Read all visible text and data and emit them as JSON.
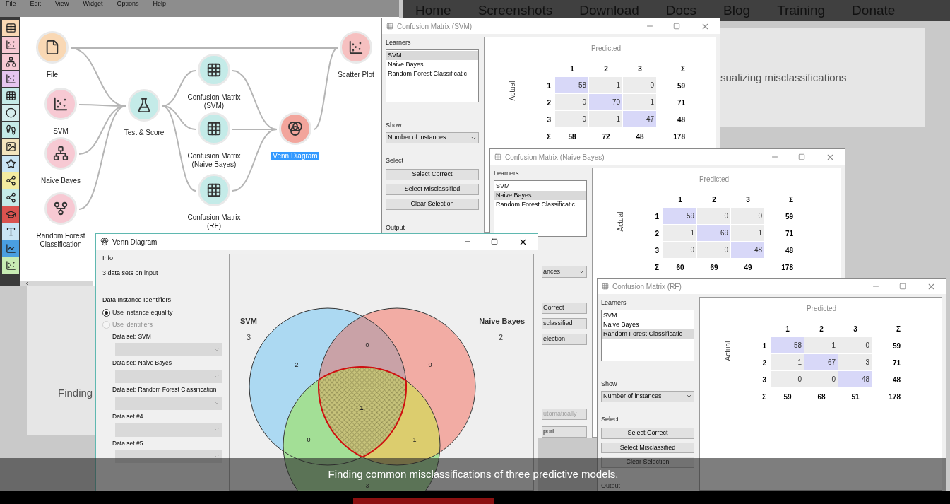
{
  "site_nav": [
    "Home",
    "Screenshots",
    "Download",
    "Docs",
    "Blog",
    "Training",
    "Donate"
  ],
  "page_texts": [
    "sualizing misclassifications",
    "Finding"
  ],
  "orange": {
    "menu": [
      "File",
      "Edit",
      "View",
      "Widget",
      "Options",
      "Help"
    ],
    "nodes": [
      {
        "kind": "file",
        "label": [
          "File"
        ],
        "selected": false
      },
      {
        "kind": "svm",
        "label": [
          "SVM"
        ],
        "selected": false
      },
      {
        "kind": "bayes",
        "label": [
          "Naive Bayes"
        ],
        "selected": false
      },
      {
        "kind": "forest",
        "label": [
          "Random Forest",
          "Classification"
        ],
        "selected": false
      },
      {
        "kind": "evaluate",
        "label": [
          "Test & Score"
        ],
        "selected": false
      },
      {
        "kind": "matrix",
        "label": [
          "Confusion Matrix",
          "(SVM)"
        ],
        "selected": false
      },
      {
        "kind": "matrix",
        "label": [
          "Confusion Matrix",
          "(Naive Bayes)"
        ],
        "selected": false
      },
      {
        "kind": "matrix",
        "label": [
          "Confusion Matrix",
          "(RF)"
        ],
        "selected": false
      },
      {
        "kind": "venn",
        "label": [
          "Venn Diagram"
        ],
        "selected": true
      },
      {
        "kind": "scatter",
        "label": [
          "Scatter Plot"
        ],
        "selected": false
      }
    ]
  },
  "confusion_windows": [
    {
      "title": "Confusion Matrix (SVM)",
      "learners_title": "Learners",
      "learners": [
        {
          "name": "SVM",
          "selected": true
        },
        {
          "name": "Naive Bayes",
          "selected": false
        },
        {
          "name": "Random Forest Classificatic",
          "selected": false
        }
      ],
      "show_title": "Show",
      "show_value": "Number of instances",
      "select_title": "Select",
      "buttons": [
        "Select Correct",
        "Select Misclassified",
        "Clear Selection"
      ],
      "output_title": "Output",
      "predicted": "Predicted",
      "actual": "Actual",
      "columns": [
        "1",
        "2",
        "3",
        "Σ"
      ],
      "rows": [
        {
          "label": "1",
          "cells": [
            {
              "value": "58",
              "highlighted": true
            },
            {
              "value": "1",
              "highlighted": false
            },
            {
              "value": "0",
              "highlighted": false
            }
          ],
          "total": "59"
        },
        {
          "label": "2",
          "cells": [
            {
              "value": "0",
              "highlighted": false
            },
            {
              "value": "70",
              "highlighted": true
            },
            {
              "value": "1",
              "highlighted": false
            }
          ],
          "total": "71"
        },
        {
          "label": "3",
          "cells": [
            {
              "value": "0",
              "highlighted": false
            },
            {
              "value": "1",
              "highlighted": false
            },
            {
              "value": "47",
              "highlighted": true
            }
          ],
          "total": "48"
        }
      ],
      "sum_row": {
        "label": "Σ",
        "cells": [
          "58",
          "72",
          "48"
        ],
        "total": "178"
      }
    },
    {
      "title": "Confusion Matrix (Naive Bayes)",
      "learners_title": "Learners",
      "learners": [
        {
          "name": "SVM",
          "selected": false
        },
        {
          "name": "Naive Bayes",
          "selected": true
        },
        {
          "name": "Random Forest Classificatic",
          "selected": false
        }
      ],
      "visible_controls": [
        {
          "kind": "dropdown",
          "text": "ances",
          "disabled": false
        },
        {
          "kind": "button",
          "text": "Correct",
          "disabled": false
        },
        {
          "kind": "button",
          "text": "sclassified",
          "disabled": false
        },
        {
          "kind": "button",
          "text": "election",
          "disabled": false
        },
        {
          "kind": "button",
          "text": "utomatically",
          "disabled": true
        },
        {
          "kind": "button",
          "text": "port",
          "disabled": false
        }
      ],
      "predicted": "Predicted",
      "actual": "Actual",
      "columns": [
        "1",
        "2",
        "3",
        "Σ"
      ],
      "rows": [
        {
          "label": "1",
          "cells": [
            {
              "value": "59",
              "highlighted": true
            },
            {
              "value": "0",
              "highlighted": false
            },
            {
              "value": "0",
              "highlighted": false
            }
          ],
          "total": "59"
        },
        {
          "label": "2",
          "cells": [
            {
              "value": "1",
              "highlighted": false
            },
            {
              "value": "69",
              "highlighted": true
            },
            {
              "value": "1",
              "highlighted": false
            }
          ],
          "total": "71"
        },
        {
          "label": "3",
          "cells": [
            {
              "value": "0",
              "highlighted": false
            },
            {
              "value": "0",
              "highlighted": false
            },
            {
              "value": "48",
              "highlighted": true
            }
          ],
          "total": "48"
        }
      ],
      "sum_row": {
        "label": "Σ",
        "cells": [
          "60",
          "69",
          "49"
        ],
        "total": "178"
      }
    },
    {
      "title": "Confusion Matrix (RF)",
      "learners_title": "Learners",
      "learners": [
        {
          "name": "SVM",
          "selected": false
        },
        {
          "name": "Naive Bayes",
          "selected": false
        },
        {
          "name": "Random Forest Classificatic",
          "selected": true
        }
      ],
      "show_title": "Show",
      "show_value": "Number of instances",
      "select_title": "Select",
      "buttons": [
        "Select Correct",
        "Select Misclassified",
        "Clear Selection"
      ],
      "output_title": "Output",
      "predicted": "Predicted",
      "actual": "Actual",
      "columns": [
        "1",
        "2",
        "3",
        "Σ"
      ],
      "rows": [
        {
          "label": "1",
          "cells": [
            {
              "value": "58",
              "highlighted": true
            },
            {
              "value": "1",
              "highlighted": false
            },
            {
              "value": "0",
              "highlighted": false
            }
          ],
          "total": "59"
        },
        {
          "label": "2",
          "cells": [
            {
              "value": "1",
              "highlighted": false
            },
            {
              "value": "67",
              "highlighted": true
            },
            {
              "value": "3",
              "highlighted": false
            }
          ],
          "total": "71"
        },
        {
          "label": "3",
          "cells": [
            {
              "value": "0",
              "highlighted": false
            },
            {
              "value": "0",
              "highlighted": false
            },
            {
              "value": "48",
              "highlighted": true
            }
          ],
          "total": "48"
        }
      ],
      "sum_row": {
        "label": "Σ",
        "cells": [
          "59",
          "68",
          "51"
        ],
        "total": "178"
      }
    }
  ],
  "venn_window": {
    "title": "Venn Diagram",
    "info_title": "Info",
    "info_text": "3 data sets on input",
    "ids_title": "Data Instance Identifiers",
    "id_options": [
      {
        "label": "Use instance equality",
        "selected": true,
        "disabled": false
      },
      {
        "label": "Use identifiers",
        "selected": false,
        "disabled": true
      }
    ],
    "datasets": [
      {
        "label": "Data set: SVM",
        "disabled": true
      },
      {
        "label": "Data set: Naive Bayes",
        "disabled": true
      },
      {
        "label": "Data set: Random Forest Classification",
        "disabled": true
      },
      {
        "label": "Data set #4",
        "disabled": true
      },
      {
        "label": "Data set #5",
        "disabled": true
      }
    ],
    "sets": [
      {
        "name": "SVM",
        "count": "3",
        "color": "#acd9f2"
      },
      {
        "name": "Naive Bayes",
        "count": "2",
        "color": "#f2aca4"
      },
      {
        "color": "#a8e39b"
      }
    ],
    "regions": [
      {
        "count": "2",
        "selected": false
      },
      {
        "count": "0",
        "selected": false
      },
      {
        "count": "0",
        "selected": false
      },
      {
        "count": "1",
        "selected": true
      },
      {
        "count": "0",
        "selected": false
      },
      {
        "count": "1",
        "selected": false
      },
      {
        "count": "3",
        "selected": false
      }
    ]
  },
  "caption": "Finding common misclassifications of three predictive models."
}
